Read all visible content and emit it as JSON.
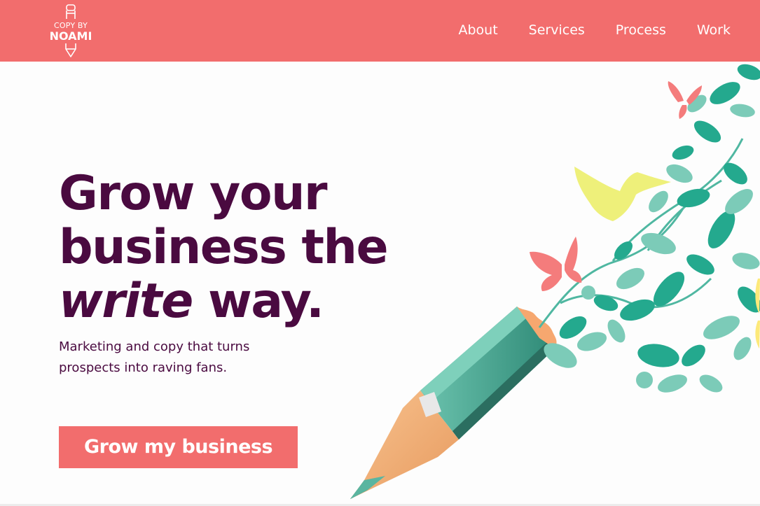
{
  "header": {
    "brand": {
      "line1": "COPY BY",
      "line2": "NOAMI"
    },
    "nav": [
      "About",
      "Services",
      "Process",
      "Work"
    ]
  },
  "hero": {
    "title_line1": "Grow your",
    "title_line2": "business the",
    "title_line3_italic": "write",
    "title_line3_rest": " way.",
    "subtitle_line1": "Marketing and copy that turns",
    "subtitle_line2": "prospects into raving fans.",
    "cta_label": "Grow my business"
  },
  "illustration": {
    "subject": "pencil-with-leaves-birds-butterflies",
    "icons": [
      "pencil-icon",
      "leaf-icon",
      "bird-icon",
      "butterfly-icon"
    ]
  },
  "colors": {
    "brand_coral": "#f26d6d",
    "heading_plum": "#4a0a40",
    "teal": "#24a98e",
    "teal_light": "#7ccbb8",
    "yellow": "#eef07a",
    "pencil_wood": "#f5b37e",
    "background": "#fdfdfd"
  }
}
